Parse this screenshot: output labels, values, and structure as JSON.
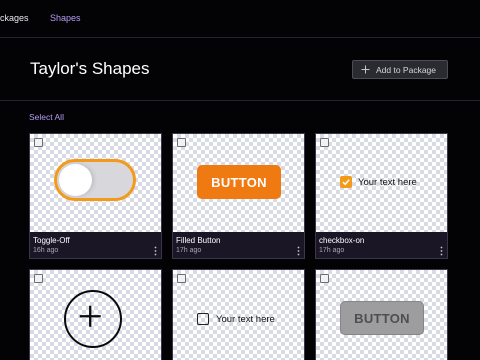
{
  "nav": {
    "packages_label": "ackages",
    "shapes_label": "Shapes"
  },
  "header": {
    "title": "Taylor's Shapes",
    "add_button_label": "Add to Package"
  },
  "select_all_label": "Select All",
  "cards": [
    {
      "name": "Toggle-Off",
      "time": "16h ago",
      "preview": "toggle-off"
    },
    {
      "name": "Filled Button",
      "time": "17h ago",
      "preview": "filled-button",
      "preview_text": "BUTTON"
    },
    {
      "name": "checkbox-on",
      "time": "17h ago",
      "preview": "checkbox-on",
      "preview_text": "Your text here"
    },
    {
      "preview": "add-circle"
    },
    {
      "preview": "checkbox-off",
      "preview_text": "Your text here"
    },
    {
      "preview": "disabled-button",
      "preview_text": "BUTTON"
    }
  ],
  "colors": {
    "background": "#030305",
    "accent_purple": "#b69cf5",
    "toggle_orange": "#f39a1b",
    "button_orange": "#f07a12",
    "card_footer": "#1a1626",
    "disabled_gray": "#9d9d9f"
  }
}
